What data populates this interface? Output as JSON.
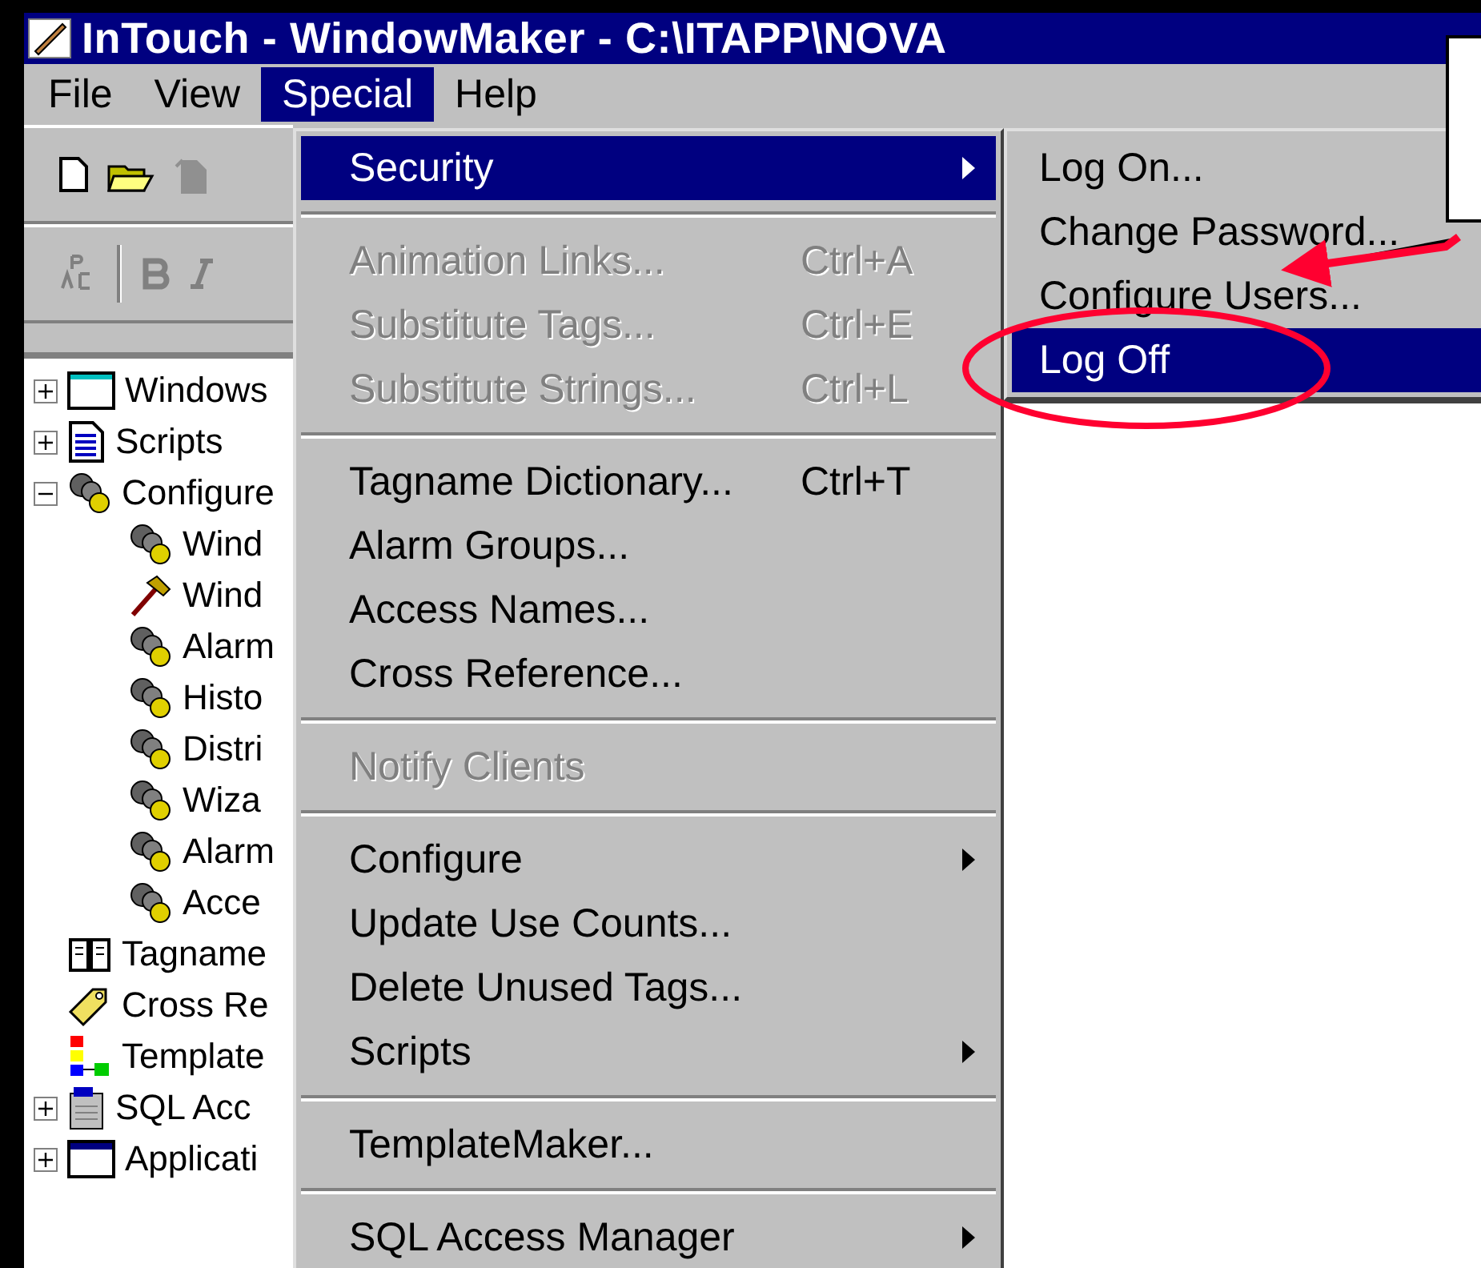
{
  "window": {
    "title": "InTouch - WindowMaker - C:\\ITAPP\\NOVA"
  },
  "menubar": [
    {
      "label": "File",
      "selected": false
    },
    {
      "label": "View",
      "selected": false
    },
    {
      "label": "Special",
      "selected": true
    },
    {
      "label": "Help",
      "selected": false
    }
  ],
  "tree": [
    {
      "label": "Windows",
      "kind": "window",
      "expanded": false
    },
    {
      "label": "Scripts",
      "kind": "script",
      "expanded": false
    },
    {
      "label": "Configure",
      "kind": "gears",
      "expanded": true,
      "children": [
        {
          "label": "Wind",
          "kind": "gears"
        },
        {
          "label": "Wind",
          "kind": "hammer"
        },
        {
          "label": "Alarm",
          "kind": "gears"
        },
        {
          "label": "Histo",
          "kind": "gears"
        },
        {
          "label": "Distri",
          "kind": "gears"
        },
        {
          "label": "Wiza",
          "kind": "gears"
        },
        {
          "label": "Alarm",
          "kind": "gears"
        },
        {
          "label": "Acce",
          "kind": "gears"
        }
      ]
    },
    {
      "label": "Tagname",
      "kind": "book"
    },
    {
      "label": "Cross Re",
      "kind": "tag"
    },
    {
      "label": "Template",
      "kind": "template"
    },
    {
      "label": "SQL Acc",
      "kind": "sql",
      "expanded": false
    },
    {
      "label": "Applicati",
      "kind": "app",
      "expanded": false
    }
  ],
  "special_menu": [
    {
      "kind": "item",
      "label": "Security",
      "selected": true,
      "disabled": false,
      "submenu": true
    },
    {
      "kind": "separator"
    },
    {
      "kind": "item",
      "label": "Animation Links...",
      "shortcut": "Ctrl+A",
      "selected": false,
      "disabled": true,
      "submenu": false
    },
    {
      "kind": "item",
      "label": "Substitute Tags...",
      "shortcut": "Ctrl+E",
      "selected": false,
      "disabled": true,
      "submenu": false
    },
    {
      "kind": "item",
      "label": "Substitute Strings...",
      "shortcut": "Ctrl+L",
      "selected": false,
      "disabled": true,
      "submenu": false
    },
    {
      "kind": "separator"
    },
    {
      "kind": "item",
      "label": "Tagname Dictionary...",
      "shortcut": "Ctrl+T",
      "selected": false,
      "disabled": false,
      "submenu": false
    },
    {
      "kind": "item",
      "label": "Alarm Groups...",
      "selected": false,
      "disabled": false,
      "submenu": false
    },
    {
      "kind": "item",
      "label": "Access Names...",
      "selected": false,
      "disabled": false,
      "submenu": false
    },
    {
      "kind": "item",
      "label": "Cross Reference...",
      "selected": false,
      "disabled": false,
      "submenu": false
    },
    {
      "kind": "separator"
    },
    {
      "kind": "item",
      "label": "Notify Clients",
      "selected": false,
      "disabled": true,
      "submenu": false
    },
    {
      "kind": "separator"
    },
    {
      "kind": "item",
      "label": "Configure",
      "selected": false,
      "disabled": false,
      "submenu": true
    },
    {
      "kind": "item",
      "label": "Update Use Counts...",
      "selected": false,
      "disabled": false,
      "submenu": false
    },
    {
      "kind": "item",
      "label": "Delete Unused Tags...",
      "selected": false,
      "disabled": false,
      "submenu": false
    },
    {
      "kind": "item",
      "label": "Scripts",
      "selected": false,
      "disabled": false,
      "submenu": true
    },
    {
      "kind": "separator"
    },
    {
      "kind": "item",
      "label": "TemplateMaker...",
      "selected": false,
      "disabled": false,
      "submenu": false
    },
    {
      "kind": "separator"
    },
    {
      "kind": "item",
      "label": "SQL Access Manager",
      "selected": false,
      "disabled": false,
      "submenu": true
    }
  ],
  "security_submenu": [
    {
      "label": "Log On...",
      "selected": false
    },
    {
      "label": "Change Password...",
      "selected": false
    },
    {
      "label": "Configure Users...",
      "selected": false
    },
    {
      "label": "Log Off",
      "selected": true
    }
  ]
}
